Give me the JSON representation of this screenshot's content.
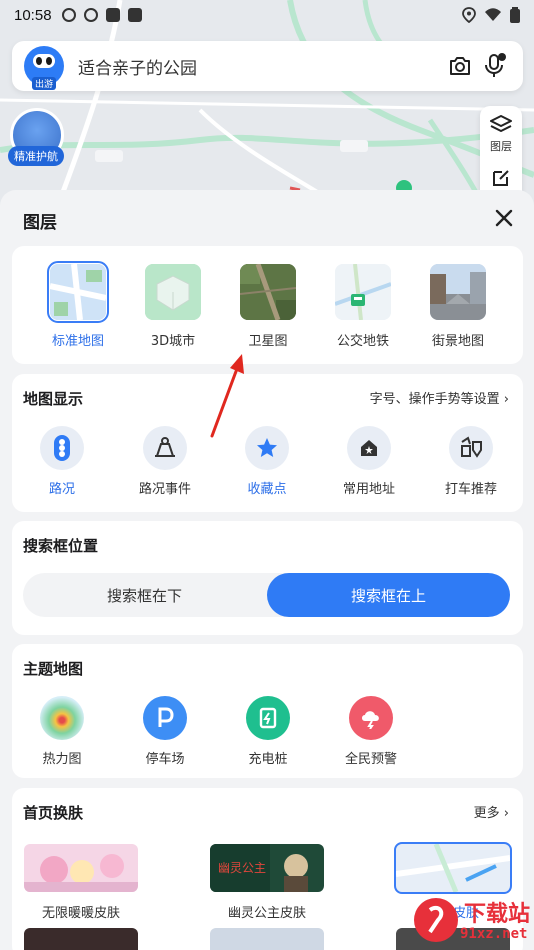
{
  "status_bar": {
    "time": "10:58"
  },
  "search": {
    "logo_tag": "出游",
    "placeholder": "适合亲子的公园"
  },
  "map_overlay": {
    "avatar_label": "精准护航",
    "layer_button_label": "图层"
  },
  "sheet": {
    "title": "图层",
    "layer_types": [
      {
        "label": "标准地图",
        "active": true
      },
      {
        "label": "3D城市",
        "active": false
      },
      {
        "label": "卫星图",
        "active": false
      },
      {
        "label": "公交地铁",
        "active": false
      },
      {
        "label": "街景地图",
        "active": false
      }
    ],
    "map_display": {
      "title": "地图显示",
      "settings_link": "字号、操作手势等设置",
      "items": [
        {
          "label": "路况",
          "active": true
        },
        {
          "label": "路况事件",
          "active": false
        },
        {
          "label": "收藏点",
          "active": true
        },
        {
          "label": "常用地址",
          "active": false
        },
        {
          "label": "打车推荐",
          "active": false
        }
      ]
    },
    "search_position": {
      "title": "搜索框位置",
      "options": [
        "搜索框在下",
        "搜索框在上"
      ],
      "selected": "搜索框在上"
    },
    "theme_map": {
      "title": "主题地图",
      "items": [
        {
          "label": "热力图"
        },
        {
          "label": "停车场"
        },
        {
          "label": "充电桩"
        },
        {
          "label": "全民预警"
        }
      ]
    },
    "skins": {
      "title": "首页换肤",
      "more": "更多",
      "items": [
        {
          "label": "无限暖暖皮肤"
        },
        {
          "label": "幽灵公主皮肤"
        },
        {
          "label": "默认皮肤",
          "active": true
        }
      ]
    }
  },
  "watermark": {
    "brand": "下载站",
    "site": "91xz.net"
  },
  "colors": {
    "accent": "#2f7bf5",
    "active_text": "#2d6fe8",
    "sheet_bg": "#f2f3f5",
    "parking": "#3d8ef5",
    "charging": "#1fbf8f",
    "warning": "#f05a6a"
  }
}
